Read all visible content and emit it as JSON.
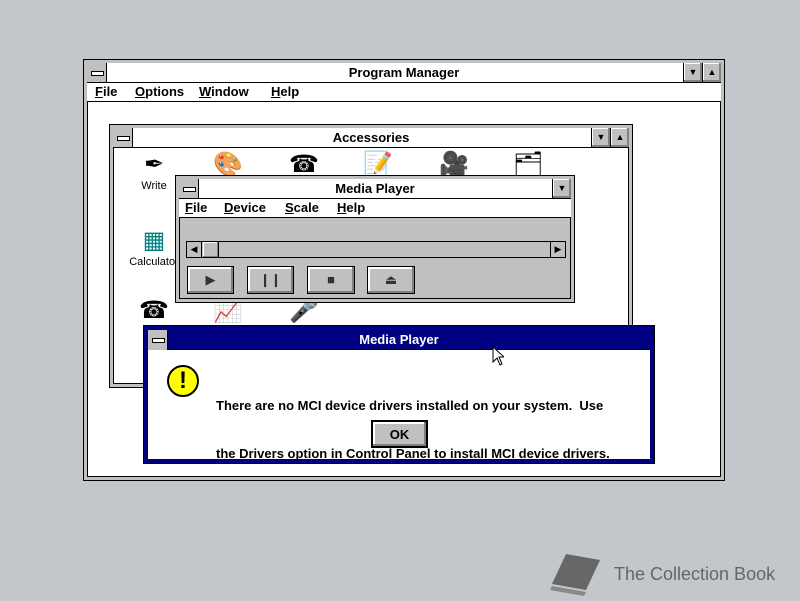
{
  "program_manager": {
    "title": "Program Manager",
    "menu": [
      "File",
      "Options",
      "Window",
      "Help"
    ]
  },
  "accessories": {
    "title": "Accessories",
    "icons": [
      {
        "label": "Write",
        "glyph": "✒"
      },
      {
        "label": "",
        "glyph": "🎨"
      },
      {
        "label": "",
        "glyph": "☎"
      },
      {
        "label": "",
        "glyph": "📝"
      },
      {
        "label": "",
        "glyph": "🎥"
      },
      {
        "label": "",
        "glyph": "🗂"
      },
      {
        "label": "Calculator",
        "glyph": "▦"
      },
      {
        "label": "",
        "glyph": "☎"
      },
      {
        "label": "",
        "glyph": "📈"
      },
      {
        "label": "",
        "glyph": "🎤"
      }
    ]
  },
  "media_player": {
    "title": "Media Player",
    "menu": [
      "File",
      "Device",
      "Scale",
      "Help"
    ],
    "controls": {
      "play": "play-icon",
      "pause": "pause-icon",
      "stop": "stop-icon",
      "eject": "eject-icon"
    },
    "position": 0
  },
  "dialog": {
    "title": "Media Player",
    "message_line1": "There are no MCI device drivers installed on your system.  Use",
    "message_line2": "the Drivers option in Control Panel to install MCI device drivers.",
    "ok_label": "OK",
    "icon": "exclamation-icon"
  },
  "watermark": {
    "text": "The Collection Book"
  },
  "colors": {
    "desktop": "#c3c7cb",
    "active_title": "#000080",
    "window_frame": "#c0c0c0"
  }
}
